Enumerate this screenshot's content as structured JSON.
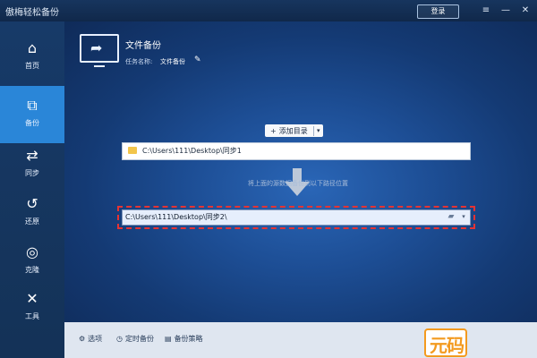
{
  "app": {
    "title": "傲梅轻松备份"
  },
  "titlebar": {
    "login_label": "登录",
    "menu_icon": "≡",
    "minimize_icon": "—",
    "close_icon": "✕"
  },
  "sidebar": {
    "items": [
      {
        "label": "首页",
        "icon": "home-icon",
        "glyph": "⌂",
        "active": false
      },
      {
        "label": "备份",
        "icon": "backup-icon",
        "glyph": "⧉",
        "active": true
      },
      {
        "label": "同步",
        "icon": "sync-icon",
        "glyph": "⇄",
        "active": false
      },
      {
        "label": "还原",
        "icon": "restore-icon",
        "glyph": "↺",
        "active": false
      },
      {
        "label": "克隆",
        "icon": "clone-icon",
        "glyph": "◎",
        "active": false
      },
      {
        "label": "工具",
        "icon": "tools-icon",
        "glyph": "✕",
        "active": false
      }
    ]
  },
  "main": {
    "title": "文件备份",
    "task_label": "任务名称:",
    "task_value": "文件备份",
    "add_dir_label": "添加目录",
    "source_path": "C:\\Users\\111\\Desktop\\同步1",
    "hint": "将上面的源数据备份到以下路径位置",
    "dest_path": "C:\\Users\\111\\Desktop\\同步2\\"
  },
  "bottom": {
    "options": [
      {
        "label": "选项",
        "icon": "gear-icon",
        "glyph": "⚙"
      },
      {
        "label": "定时备份",
        "icon": "clock-icon",
        "glyph": "◷"
      },
      {
        "label": "备份策略",
        "icon": "strategy-icon",
        "glyph": "▤"
      }
    ]
  },
  "watermark": {
    "text": "元码"
  },
  "colors": {
    "accent": "#2a86d8",
    "danger": "#e53333",
    "watermark": "#f39a1f"
  }
}
